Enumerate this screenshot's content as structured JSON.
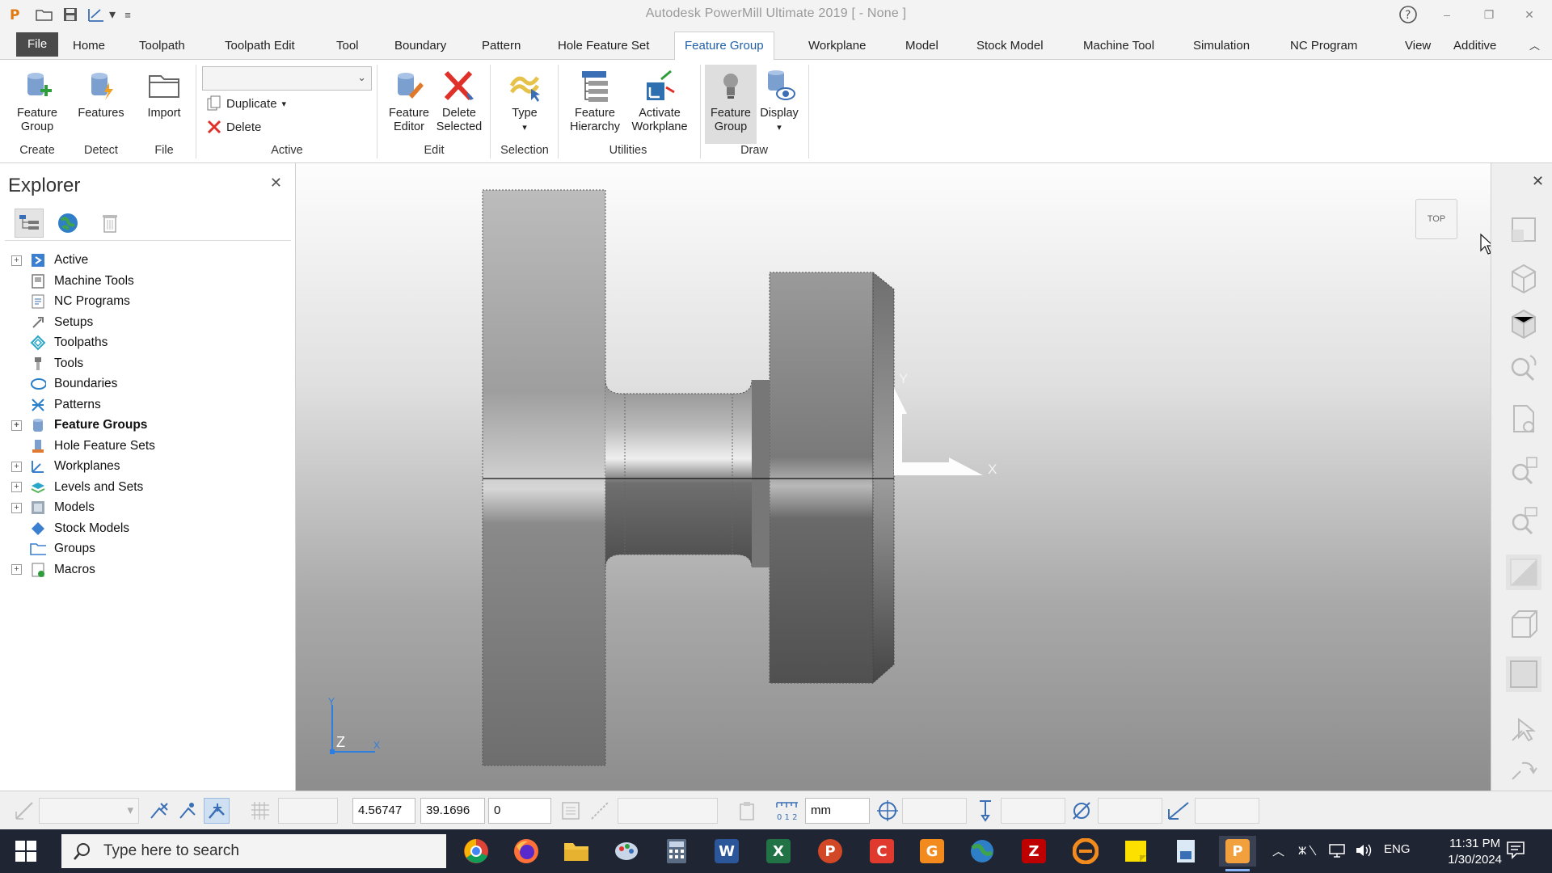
{
  "window": {
    "title": "Autodesk PowerMill Ultimate 2019    [ - None ]",
    "help": "?",
    "minimize": "–",
    "maximize": "❐",
    "close": "✕"
  },
  "tabs": [
    "File",
    "Home",
    "Toolpath",
    "Toolpath Edit",
    "Tool",
    "Boundary",
    "Pattern",
    "Hole Feature Set",
    "Feature Group",
    "Workplane",
    "Model",
    "Stock Model",
    "Machine Tool",
    "Simulation",
    "NC Program",
    "View",
    "Additive"
  ],
  "active_tab": "Feature Group",
  "ribbon": {
    "create": {
      "btn1": "Feature",
      "btn2": "Group",
      "group": "Create"
    },
    "detect": {
      "btn": "Features",
      "group": "Detect"
    },
    "file": {
      "btn": "Import",
      "group": "File"
    },
    "active": {
      "duplicate": "Duplicate",
      "delete": "Delete",
      "group": "Active",
      "combo_value": ""
    },
    "edit": {
      "editor1": "Feature",
      "editor2": "Editor",
      "delete1": "Delete",
      "delete2": "Selected",
      "group": "Edit"
    },
    "selection": {
      "btn": "Type",
      "group": "Selection"
    },
    "utilities": {
      "hier1": "Feature",
      "hier2": "Hierarchy",
      "act1": "Activate",
      "act2": "Workplane",
      "group": "Utilities"
    },
    "draw": {
      "fg1": "Feature",
      "fg2": "Group",
      "display": "Display",
      "group": "Draw"
    }
  },
  "explorer": {
    "title": "Explorer",
    "close": "✕",
    "items": [
      {
        "label": "Active",
        "expandable": true,
        "bold": false,
        "icon": "active-icon"
      },
      {
        "label": "Machine Tools",
        "expandable": false,
        "bold": false,
        "icon": "machine-tool-icon"
      },
      {
        "label": "NC Programs",
        "expandable": false,
        "bold": false,
        "icon": "nc-program-icon"
      },
      {
        "label": "Setups",
        "expandable": false,
        "bold": false,
        "icon": "setup-icon"
      },
      {
        "label": "Toolpaths",
        "expandable": false,
        "bold": false,
        "icon": "toolpath-icon"
      },
      {
        "label": "Tools",
        "expandable": false,
        "bold": false,
        "icon": "tool-icon"
      },
      {
        "label": "Boundaries",
        "expandable": false,
        "bold": false,
        "icon": "boundary-icon"
      },
      {
        "label": "Patterns",
        "expandable": false,
        "bold": false,
        "icon": "pattern-icon"
      },
      {
        "label": "Feature Groups",
        "expandable": true,
        "bold": true,
        "icon": "feature-group-icon"
      },
      {
        "label": "Hole Feature Sets",
        "expandable": false,
        "bold": false,
        "icon": "hole-feature-icon"
      },
      {
        "label": "Workplanes",
        "expandable": true,
        "bold": false,
        "icon": "workplane-icon"
      },
      {
        "label": "Levels and Sets",
        "expandable": true,
        "bold": false,
        "icon": "levels-icon"
      },
      {
        "label": "Models",
        "expandable": true,
        "bold": false,
        "icon": "model-icon"
      },
      {
        "label": "Stock Models",
        "expandable": false,
        "bold": false,
        "icon": "stock-model-icon"
      },
      {
        "label": "Groups",
        "expandable": false,
        "bold": false,
        "icon": "folder-icon"
      },
      {
        "label": "Macros",
        "expandable": true,
        "bold": false,
        "icon": "macro-icon"
      }
    ]
  },
  "viewport": {
    "view_label": "TOP",
    "axis_x": "X",
    "axis_y": "Y",
    "triad_z": "Z",
    "triad_y": "Y",
    "triad_x": "X"
  },
  "statusbar": {
    "x_value": "4.56747",
    "y_value": "39.1696",
    "z_value": "0",
    "units": "mm"
  },
  "taskbar": {
    "search_placeholder": "Type here to search",
    "language": "ENG",
    "time": "11:31 PM",
    "date": "1/30/2024"
  },
  "colors": {
    "accent": "#1f5fa9",
    "taskbar": "#1f2533",
    "file_tab": "#4a4a4a"
  }
}
